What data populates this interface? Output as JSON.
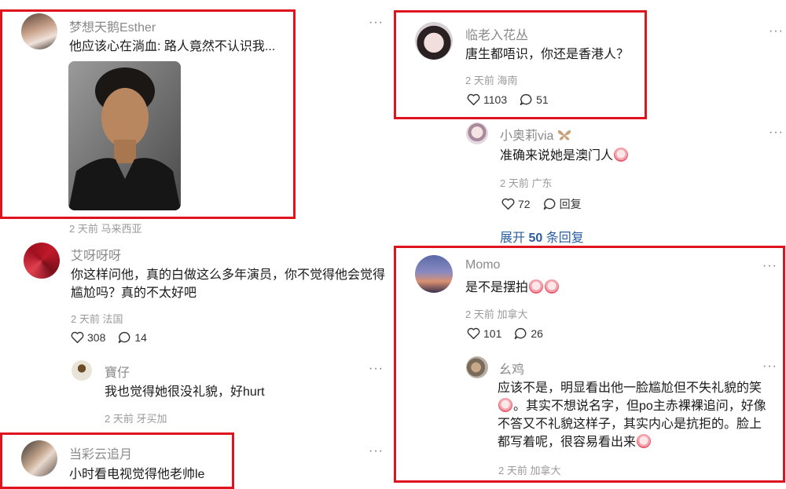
{
  "comments": {
    "c1": {
      "name": "梦想天鹅Esther",
      "text": "他应该心在淌血: 路人竟然不认识我...",
      "meta": "2 天前 马来西亚"
    },
    "c2": {
      "name": "艾呀呀呀",
      "text": "你这样问他，真的白做这么多年演员，你不觉得他会觉得尴尬吗？真的不太好吧",
      "meta": "2 天前 法国",
      "likes": "308",
      "replies": "14"
    },
    "c2r": {
      "name": "寶仔",
      "text": "我也觉得她很没礼貌，好hurt",
      "meta": "2 天前 牙买加"
    },
    "c3": {
      "name": "当彩云追月",
      "text": "小时看电视觉得他老帅le"
    },
    "c4": {
      "name": "临老入花丛",
      "text": "唐生都唔识，你还是香港人？",
      "meta": "2 天前 海南",
      "likes": "1103",
      "replies": "51"
    },
    "c4r": {
      "name": "小奥莉via",
      "text": "准确来说她是澳门人",
      "meta": "2 天前 广东",
      "likes": "72",
      "reply_label": "回复"
    },
    "expand": {
      "prefix": "展开",
      "count": "50",
      "suffix": "条回复"
    },
    "c5": {
      "name": "Momo",
      "text": "是不是摆拍",
      "meta": "2 天前 加拿大",
      "likes": "101",
      "replies": "26"
    },
    "c5r": {
      "name": "幺鸡",
      "line1": "应该不是，明显看出他一脸尴尬但不失礼貌的笑",
      "line2": "。其实不想说名字，但po主赤裸裸追问，好像",
      "line3": "不答又不礼貌这样子，其实内心是抗拒的。脸上",
      "line4": "都写着呢，很容易看出来",
      "meta": "2 天前 加拿大"
    }
  },
  "more_label": "···",
  "icons": [
    "heart-icon",
    "comment-icon",
    "more-icon",
    "butterfly-icon",
    "emoji-icon"
  ],
  "colors": {
    "highlight": "#e0141e",
    "link": "#2a5d9f",
    "meta": "#9a9a9a"
  }
}
